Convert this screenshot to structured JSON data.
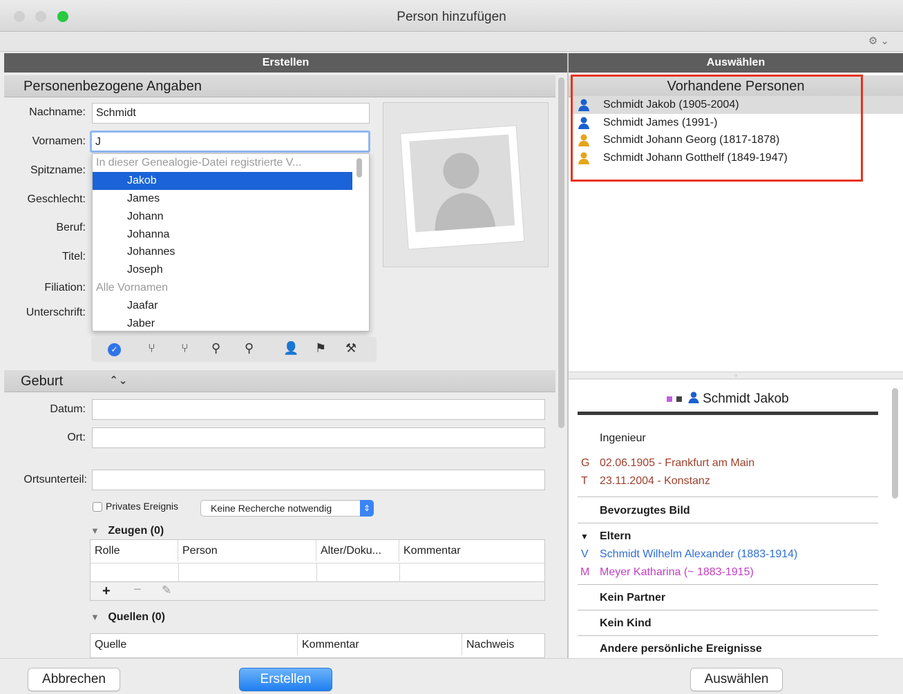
{
  "window": {
    "title": "Person hinzufügen",
    "traffic_colors": [
      "#d0d0d0",
      "#d0d0d0",
      "#29c940"
    ]
  },
  "left_pane": {
    "header": "Erstellen",
    "personal_section": "Personenbezogene Angaben",
    "labels": {
      "nachname": "Nachname:",
      "vornamen": "Vornamen:",
      "spitzname": "Spitzname:",
      "geschlecht": "Geschlecht:",
      "beruf": "Beruf:",
      "titel": "Titel:",
      "filiation": "Filiation:",
      "unterschrift": "Unterschrift:"
    },
    "values": {
      "nachname": "Schmidt",
      "vornamen": "J"
    },
    "autocomplete": {
      "group_registered": "In dieser Genealogie-Datei registrierte V...",
      "registered": [
        "Jakob",
        "James",
        "Johann",
        "Johanna",
        "Johannes",
        "Joseph"
      ],
      "group_all": "Alle Vornamen",
      "all": [
        "Jaafar",
        "Jaber"
      ],
      "selected": "Jakob"
    },
    "birth": {
      "section": "Geburt",
      "labels": {
        "datum": "Datum:",
        "ort": "Ort:",
        "ortsunterteil": "Ortsunterteil:"
      },
      "private_label": "Privates Ereignis",
      "research_option": "Keine Recherche notwendig",
      "zeugen_label": "Zeugen (0)",
      "zeugen_columns": [
        "Rolle",
        "Person",
        "Alter/Doku...",
        "Kommentar"
      ],
      "quellen_label": "Quellen (0)",
      "quellen_columns": [
        "Quelle",
        "Kommentar",
        "Nachweis"
      ]
    }
  },
  "right_pane": {
    "header": "Auswählen",
    "list_title": "Vorhandene Personen",
    "persons": [
      {
        "name": "Schmidt Jakob (1905-2004)",
        "gender_color": "#1a5fd1"
      },
      {
        "name": "Schmidt James (1991-)",
        "gender_color": "#1a5fd1"
      },
      {
        "name": "Schmidt Johann Georg (1817-1878)",
        "gender_color": "#e6a417"
      },
      {
        "name": "Schmidt Johann Gotthelf (1849-1947)",
        "gender_color": "#e6a417"
      }
    ],
    "highlight_color": "#e8321d",
    "detail": {
      "name": "Schmidt Jakob",
      "beruf": "Ingenieur",
      "birth_letter": "G",
      "birth": "02.06.1905 - Frankfurt am Main",
      "death_letter": "T",
      "death": "23.11.2004 - Konstanz",
      "bevorzugtes_bild": "Bevorzugtes Bild",
      "eltern": "Eltern",
      "vater_letter": "V",
      "vater": "Schmidt Wilhelm Alexander (1883-1914)",
      "mutter_letter": "M",
      "mutter": "Meyer Katharina (~ 1883-1915)",
      "partner": "Kein Partner",
      "kind": "Kein Kind",
      "ereignisse": "Andere persönliche Ereignisse"
    }
  },
  "footer": {
    "cancel": "Abbrechen",
    "create": "Erstellen",
    "select": "Auswählen"
  }
}
